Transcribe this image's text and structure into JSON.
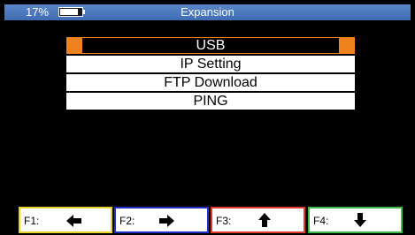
{
  "titlebar": {
    "battery_percent": "17%",
    "battery_level": 0.17,
    "title": "Expansion"
  },
  "menu": {
    "items": [
      {
        "label": "USB",
        "selected": true
      },
      {
        "label": "IP Setting",
        "selected": false
      },
      {
        "label": "FTP Download",
        "selected": false
      },
      {
        "label": "PING",
        "selected": false
      }
    ]
  },
  "fkeys": [
    {
      "label": "F1:",
      "icon": "arrow-left-icon",
      "color": "#e6d22a"
    },
    {
      "label": "F2:",
      "icon": "arrow-right-icon",
      "color": "#1f2fc8"
    },
    {
      "label": "F3:",
      "icon": "arrow-up-icon",
      "color": "#e23a2c"
    },
    {
      "label": "F4:",
      "icon": "arrow-down-icon",
      "color": "#3ab84a"
    }
  ],
  "colors": {
    "selection_accent": "#f0821e",
    "titlebar": "#4a78bf"
  }
}
